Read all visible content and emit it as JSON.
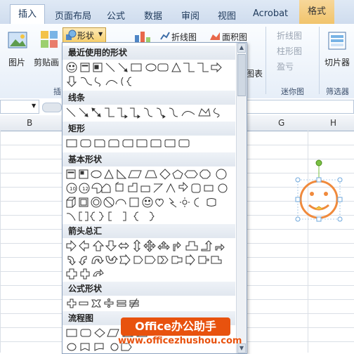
{
  "tabs": [
    {
      "label": "插入",
      "active": true
    },
    {
      "label": "页面布局"
    },
    {
      "label": "公式"
    },
    {
      "label": "数据"
    },
    {
      "label": "审阅"
    },
    {
      "label": "视图"
    },
    {
      "label": "Acrobat"
    },
    {
      "label": "格式",
      "contextual": true
    }
  ],
  "ribbon": {
    "picture_label": "图片",
    "clipart_label": "剪贴画",
    "shapes_label": "形状",
    "insert_group_fragment": "插",
    "line_chart": "折线图",
    "area_chart": "面积图",
    "table_fragment": "图表",
    "spark_line": "折线图",
    "spark_column": "柱形图",
    "spark_winloss": "盈亏",
    "sparklines_group": "迷你图",
    "slicer_label": "切片器",
    "filter_group": "筛选器"
  },
  "columns": [
    "B",
    "G",
    "H"
  ],
  "menu": {
    "sections": {
      "recent": "最近使用的形状",
      "lines": "线条",
      "rectangles": "矩形",
      "basic": "基本形状",
      "arrows": "箭头总汇",
      "equation": "公式形状",
      "flowchart": "流程图"
    }
  },
  "watermark": {
    "title": "Office办公助手",
    "url": "www.officezhushou.com"
  },
  "colors": {
    "accent": "#e8520e",
    "selection": "#6fa8dc",
    "smiley": "#f08a3c",
    "handle_green": "#7ac143"
  }
}
